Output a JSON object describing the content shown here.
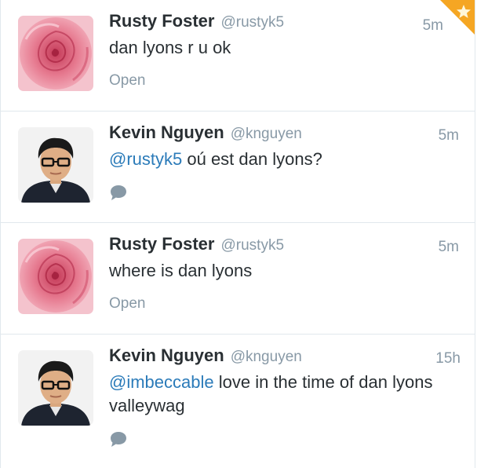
{
  "tweets": [
    {
      "name": "Rusty Foster",
      "handle": "@rustyk5",
      "time": "5m",
      "text_plain": "dan lyons r u ok",
      "action": "Open"
    },
    {
      "name": "Kevin Nguyen",
      "handle": "@knguyen",
      "time": "5m",
      "mention": "@rustyk5",
      "text_rest": " oú est dan lyons?"
    },
    {
      "name": "Rusty Foster",
      "handle": "@rustyk5",
      "time": "5m",
      "text_plain": "where is dan lyons",
      "action": "Open"
    },
    {
      "name": "Kevin Nguyen",
      "handle": "@knguyen",
      "time": "15h",
      "mention": "@imbeccable",
      "text_rest": " love in the time of dan lyons valleywag"
    }
  ],
  "colors": {
    "link": "#2b7bb9",
    "muted": "#8899a6",
    "text": "#292f33",
    "divider": "#e1e8ed",
    "favorite_corner": "#f5a623"
  },
  "icons": {
    "reply": "speech-bubble-icon",
    "favorite_corner": "star-corner-icon",
    "rose_avatar": "rose-avatar",
    "person_avatar": "person-avatar"
  }
}
